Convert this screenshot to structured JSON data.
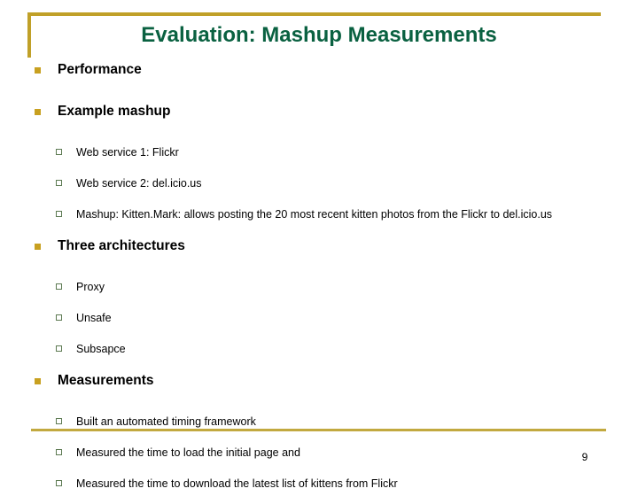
{
  "slide": {
    "title": "Evaluation: Mashup Measurements",
    "page_number": "9",
    "accent_gold": "#c0a028",
    "accent_green": "#0a6141",
    "bullet_gold": "#c8a020",
    "bullet_green": "#5d7a52",
    "bullets": [
      {
        "level": 1,
        "text": "Performance"
      },
      {
        "level": 1,
        "text": "Example mashup"
      },
      {
        "level": 2,
        "text": "Web service 1: Flickr"
      },
      {
        "level": 2,
        "text": "Web service 2: del.icio.us"
      },
      {
        "level": 2,
        "text": "Mashup: Kitten.Mark: allows posting the 20 most recent kitten photos from the Flickr to del.icio.us"
      },
      {
        "level": 1,
        "text": "Three architectures"
      },
      {
        "level": 2,
        "text": "Proxy"
      },
      {
        "level": 2,
        "text": "Unsafe"
      },
      {
        "level": 2,
        "text": "Subsapce"
      },
      {
        "level": 1,
        "text": "Measurements"
      },
      {
        "level": 2,
        "text": "Built an automated timing framework"
      },
      {
        "level": 2,
        "text": "Measured the time to load the initial page and"
      },
      {
        "level": 2,
        "text": "Measured the time to download the latest list of kittens from Flickr"
      }
    ]
  }
}
